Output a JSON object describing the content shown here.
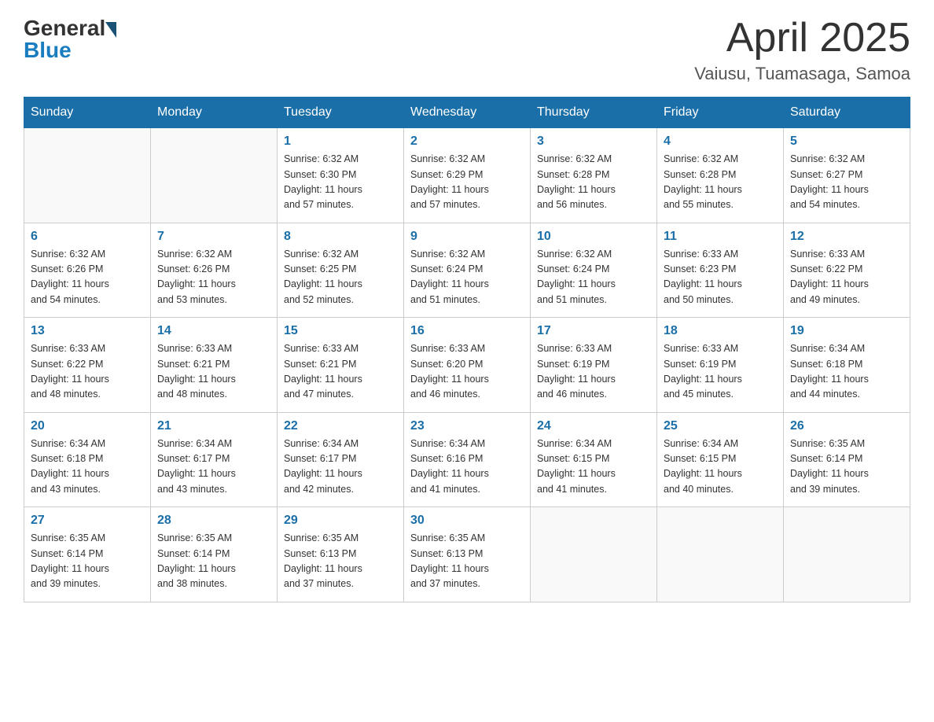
{
  "header": {
    "logo_general": "General",
    "logo_blue": "Blue",
    "month_title": "April 2025",
    "location": "Vaiusu, Tuamasaga, Samoa"
  },
  "days_of_week": [
    "Sunday",
    "Monday",
    "Tuesday",
    "Wednesday",
    "Thursday",
    "Friday",
    "Saturday"
  ],
  "weeks": [
    [
      {
        "day": "",
        "info": ""
      },
      {
        "day": "",
        "info": ""
      },
      {
        "day": "1",
        "info": "Sunrise: 6:32 AM\nSunset: 6:30 PM\nDaylight: 11 hours\nand 57 minutes."
      },
      {
        "day": "2",
        "info": "Sunrise: 6:32 AM\nSunset: 6:29 PM\nDaylight: 11 hours\nand 57 minutes."
      },
      {
        "day": "3",
        "info": "Sunrise: 6:32 AM\nSunset: 6:28 PM\nDaylight: 11 hours\nand 56 minutes."
      },
      {
        "day": "4",
        "info": "Sunrise: 6:32 AM\nSunset: 6:28 PM\nDaylight: 11 hours\nand 55 minutes."
      },
      {
        "day": "5",
        "info": "Sunrise: 6:32 AM\nSunset: 6:27 PM\nDaylight: 11 hours\nand 54 minutes."
      }
    ],
    [
      {
        "day": "6",
        "info": "Sunrise: 6:32 AM\nSunset: 6:26 PM\nDaylight: 11 hours\nand 54 minutes."
      },
      {
        "day": "7",
        "info": "Sunrise: 6:32 AM\nSunset: 6:26 PM\nDaylight: 11 hours\nand 53 minutes."
      },
      {
        "day": "8",
        "info": "Sunrise: 6:32 AM\nSunset: 6:25 PM\nDaylight: 11 hours\nand 52 minutes."
      },
      {
        "day": "9",
        "info": "Sunrise: 6:32 AM\nSunset: 6:24 PM\nDaylight: 11 hours\nand 51 minutes."
      },
      {
        "day": "10",
        "info": "Sunrise: 6:32 AM\nSunset: 6:24 PM\nDaylight: 11 hours\nand 51 minutes."
      },
      {
        "day": "11",
        "info": "Sunrise: 6:33 AM\nSunset: 6:23 PM\nDaylight: 11 hours\nand 50 minutes."
      },
      {
        "day": "12",
        "info": "Sunrise: 6:33 AM\nSunset: 6:22 PM\nDaylight: 11 hours\nand 49 minutes."
      }
    ],
    [
      {
        "day": "13",
        "info": "Sunrise: 6:33 AM\nSunset: 6:22 PM\nDaylight: 11 hours\nand 48 minutes."
      },
      {
        "day": "14",
        "info": "Sunrise: 6:33 AM\nSunset: 6:21 PM\nDaylight: 11 hours\nand 48 minutes."
      },
      {
        "day": "15",
        "info": "Sunrise: 6:33 AM\nSunset: 6:21 PM\nDaylight: 11 hours\nand 47 minutes."
      },
      {
        "day": "16",
        "info": "Sunrise: 6:33 AM\nSunset: 6:20 PM\nDaylight: 11 hours\nand 46 minutes."
      },
      {
        "day": "17",
        "info": "Sunrise: 6:33 AM\nSunset: 6:19 PM\nDaylight: 11 hours\nand 46 minutes."
      },
      {
        "day": "18",
        "info": "Sunrise: 6:33 AM\nSunset: 6:19 PM\nDaylight: 11 hours\nand 45 minutes."
      },
      {
        "day": "19",
        "info": "Sunrise: 6:34 AM\nSunset: 6:18 PM\nDaylight: 11 hours\nand 44 minutes."
      }
    ],
    [
      {
        "day": "20",
        "info": "Sunrise: 6:34 AM\nSunset: 6:18 PM\nDaylight: 11 hours\nand 43 minutes."
      },
      {
        "day": "21",
        "info": "Sunrise: 6:34 AM\nSunset: 6:17 PM\nDaylight: 11 hours\nand 43 minutes."
      },
      {
        "day": "22",
        "info": "Sunrise: 6:34 AM\nSunset: 6:17 PM\nDaylight: 11 hours\nand 42 minutes."
      },
      {
        "day": "23",
        "info": "Sunrise: 6:34 AM\nSunset: 6:16 PM\nDaylight: 11 hours\nand 41 minutes."
      },
      {
        "day": "24",
        "info": "Sunrise: 6:34 AM\nSunset: 6:15 PM\nDaylight: 11 hours\nand 41 minutes."
      },
      {
        "day": "25",
        "info": "Sunrise: 6:34 AM\nSunset: 6:15 PM\nDaylight: 11 hours\nand 40 minutes."
      },
      {
        "day": "26",
        "info": "Sunrise: 6:35 AM\nSunset: 6:14 PM\nDaylight: 11 hours\nand 39 minutes."
      }
    ],
    [
      {
        "day": "27",
        "info": "Sunrise: 6:35 AM\nSunset: 6:14 PM\nDaylight: 11 hours\nand 39 minutes."
      },
      {
        "day": "28",
        "info": "Sunrise: 6:35 AM\nSunset: 6:14 PM\nDaylight: 11 hours\nand 38 minutes."
      },
      {
        "day": "29",
        "info": "Sunrise: 6:35 AM\nSunset: 6:13 PM\nDaylight: 11 hours\nand 37 minutes."
      },
      {
        "day": "30",
        "info": "Sunrise: 6:35 AM\nSunset: 6:13 PM\nDaylight: 11 hours\nand 37 minutes."
      },
      {
        "day": "",
        "info": ""
      },
      {
        "day": "",
        "info": ""
      },
      {
        "day": "",
        "info": ""
      }
    ]
  ]
}
